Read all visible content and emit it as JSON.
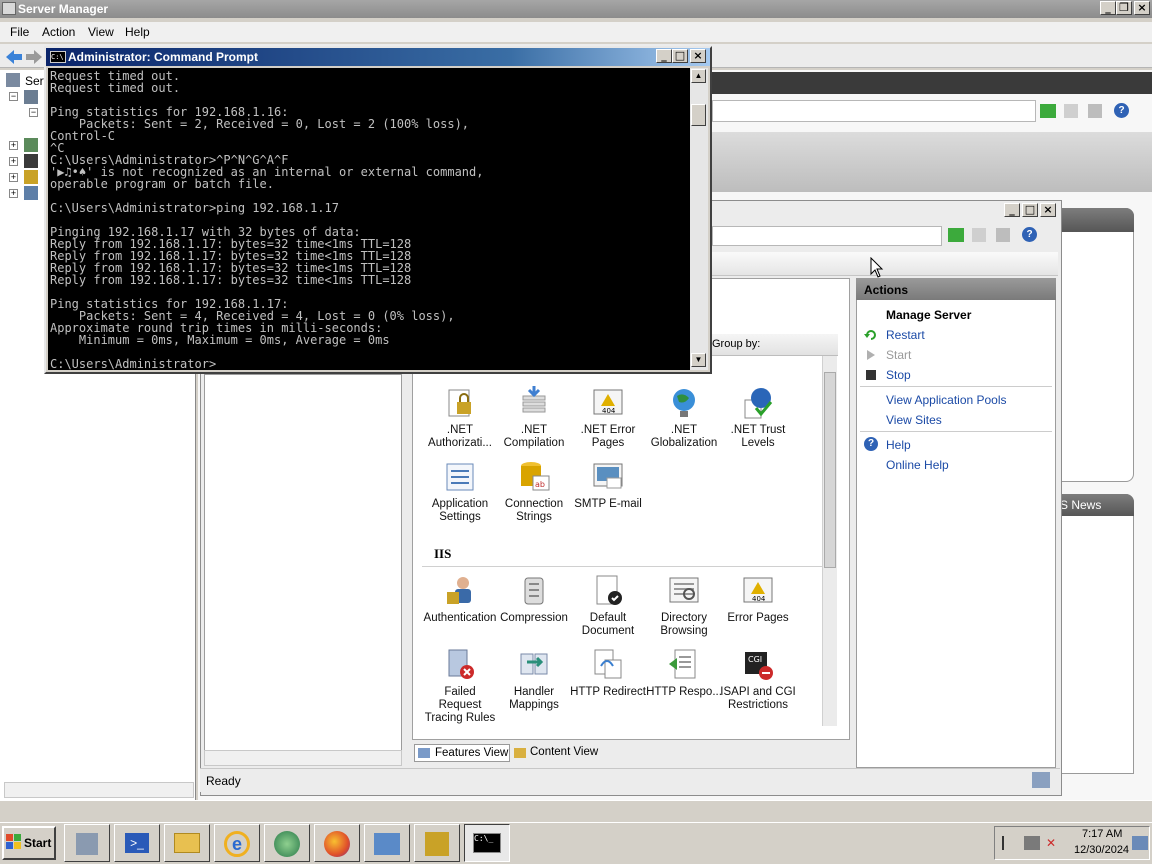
{
  "server_manager": {
    "title": "Server Manager",
    "menu": [
      "File",
      "Action",
      "View",
      "Help"
    ],
    "tree_root_label": "Serv"
  },
  "cmd": {
    "title": "Administrator: Command Prompt",
    "lines": [
      "Request timed out.",
      "Request timed out.",
      "",
      "Ping statistics for 192.168.1.16:",
      "    Packets: Sent = 2, Received = 0, Lost = 2 (100% loss),",
      "Control-C",
      "^C",
      "C:\\Users\\Administrator>^P^N^G^A^F",
      "'▶♫•♠' is not recognized as an internal or external command,",
      "operable program or batch file.",
      "",
      "C:\\Users\\Administrator>ping 192.168.1.17",
      "",
      "Pinging 192.168.1.17 with 32 bytes of data:",
      "Reply from 192.168.1.17: bytes=32 time<1ms TTL=128",
      "Reply from 192.168.1.17: bytes=32 time<1ms TTL=128",
      "Reply from 192.168.1.17: bytes=32 time<1ms TTL=128",
      "Reply from 192.168.1.17: bytes=32 time<1ms TTL=128",
      "",
      "Ping statistics for 192.168.1.17:",
      "    Packets: Sent = 4, Received = 4, Lost = 0 (0% loss),",
      "Approximate round trip times in milli-seconds:",
      "    Minimum = 0ms, Maximum = 0ms, Average = 0ms",
      "",
      "C:\\Users\\Administrator>_"
    ]
  },
  "iis": {
    "group_by_label": "Group by:",
    "section_iis": "IIS",
    "aspnet_features": [
      {
        "label": ".NET Authorizati...",
        "icon": "net-authorization-icon",
        "color": "#c9a227"
      },
      {
        "label": ".NET Compilation",
        "icon": "net-compilation-icon",
        "color": "#3f7fd1"
      },
      {
        "label": ".NET Error Pages",
        "icon": "net-error-pages-icon",
        "color": "#e0b000"
      },
      {
        "label": ".NET Globalization",
        "icon": "net-globalization-icon",
        "color": "#2f8f3f"
      },
      {
        "label": ".NET Trust Levels",
        "icon": "net-trust-levels-icon",
        "color": "#2a66b8"
      },
      {
        "label": "Application Settings",
        "icon": "application-settings-icon",
        "color": "#4a7ab8"
      },
      {
        "label": "Connection Strings",
        "icon": "connection-strings-icon",
        "color": "#d9a400"
      },
      {
        "label": "SMTP E-mail",
        "icon": "smtp-email-icon",
        "color": "#5a8fc0"
      }
    ],
    "iis_features": [
      {
        "label": "Authentication",
        "icon": "authentication-icon",
        "color": "#c9a227"
      },
      {
        "label": "Compression",
        "icon": "compression-icon",
        "color": "#888888"
      },
      {
        "label": "Default Document",
        "icon": "default-document-icon",
        "color": "#333333"
      },
      {
        "label": "Directory Browsing",
        "icon": "directory-browsing-icon",
        "color": "#777777"
      },
      {
        "label": "Error Pages",
        "icon": "error-pages-icon",
        "color": "#e0b000"
      },
      {
        "label": "Failed Request Tracing Rules",
        "icon": "failed-request-tracing-icon",
        "color": "#cc2a2a"
      },
      {
        "label": "Handler Mappings",
        "icon": "handler-mappings-icon",
        "color": "#2a8f7a"
      },
      {
        "label": "HTTP Redirect",
        "icon": "http-redirect-icon",
        "color": "#3a7fd0"
      },
      {
        "label": "HTTP Respo...",
        "icon": "http-response-headers-icon",
        "color": "#3a9a3a"
      },
      {
        "label": "ISAPI and CGI Restrictions",
        "icon": "isapi-cgi-icon",
        "color": "#222222"
      }
    ],
    "tabs": {
      "features_view": "Features View",
      "content_view": "Content View"
    },
    "status": "Ready",
    "actions": {
      "header": "Actions",
      "section": "Manage Server",
      "restart": "Restart",
      "start": "Start",
      "stop": "Stop",
      "view_app_pools": "View Application Pools",
      "view_sites": "View Sites",
      "help": "Help",
      "online_help": "Online Help"
    },
    "news_label": "S News"
  },
  "taskbar": {
    "start": "Start",
    "time": "7:17 AM",
    "date": "12/30/2024"
  }
}
